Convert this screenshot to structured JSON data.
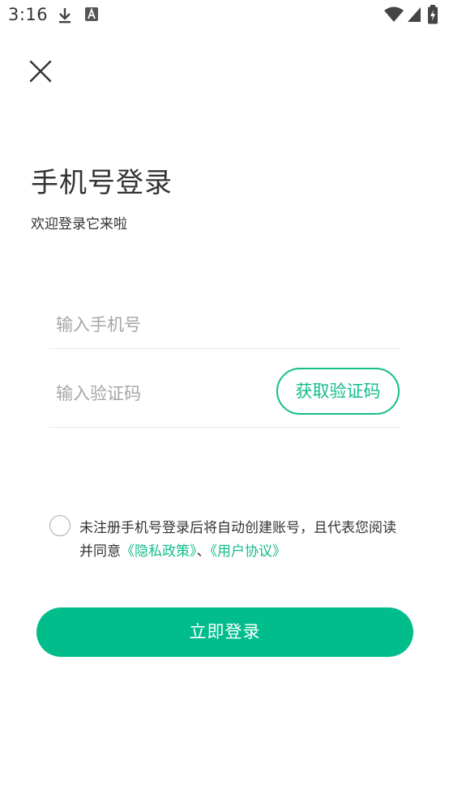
{
  "status_bar": {
    "time": "3:16",
    "icons": [
      "download-icon",
      "a-icon",
      "wifi-icon",
      "signal-icon",
      "battery-icon"
    ]
  },
  "header": {
    "close_icon": "close-icon"
  },
  "login": {
    "title": "手机号登录",
    "subtitle": "欢迎登录它来啦",
    "phone_placeholder": "输入手机号",
    "code_placeholder": "输入验证码",
    "get_code_label": "获取验证码",
    "agreement": {
      "text": "未注册手机号登录后将自动创建账号，且代表您阅读并同意",
      "privacy_link": "《隐私政策》",
      "separator": "、",
      "user_agreement_link": "《用户协议》"
    },
    "submit_label": "立即登录"
  },
  "colors": {
    "accent": "#13bd8b",
    "button": "#00bd8b",
    "placeholder": "#a6a6a6"
  }
}
